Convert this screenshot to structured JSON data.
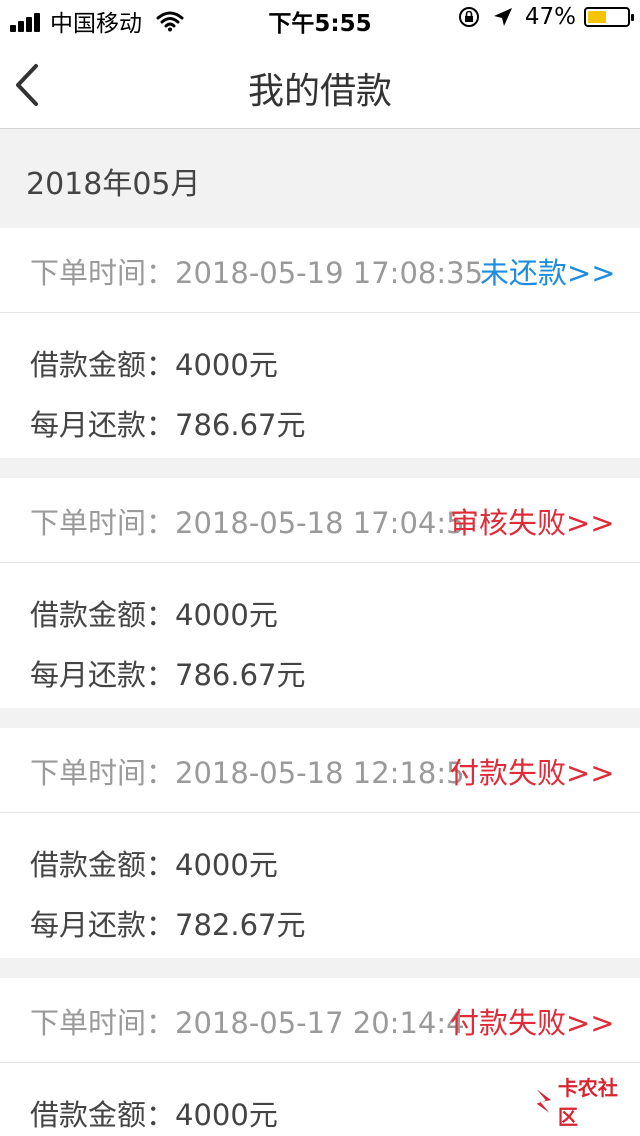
{
  "status_bar": {
    "carrier": "中国移动",
    "time": "下午5:55",
    "battery_percent": "47%",
    "battery_level": 0.47,
    "battery_color": "#f5c400"
  },
  "nav": {
    "title": "我的借款",
    "back_icon": "chevron-left-icon"
  },
  "month": "2018年05月",
  "labels": {
    "order_time": "下单时间：",
    "loan_amount": "借款金额：",
    "monthly_repay": "每月还款："
  },
  "orders": [
    {
      "time": "2018-05-19 17:08:35",
      "status": "未还款>>",
      "status_color": "#1f8ddf",
      "amount": "4000元",
      "monthly": "786.67元"
    },
    {
      "time": "2018-05-18 17:04:5",
      "status": "审核失败>>",
      "status_color": "#e02b39",
      "amount": "4000元",
      "monthly": "786.67元"
    },
    {
      "time": "2018-05-18 12:18:5",
      "status": "付款失败>>",
      "status_color": "#e02b39",
      "amount": "4000元",
      "monthly": "782.67元"
    },
    {
      "time": "2018-05-17 20:14:4",
      "status": "付款失败>>",
      "status_color": "#e02b39",
      "amount": "4000元"
    }
  ],
  "watermark": "卡农社区"
}
